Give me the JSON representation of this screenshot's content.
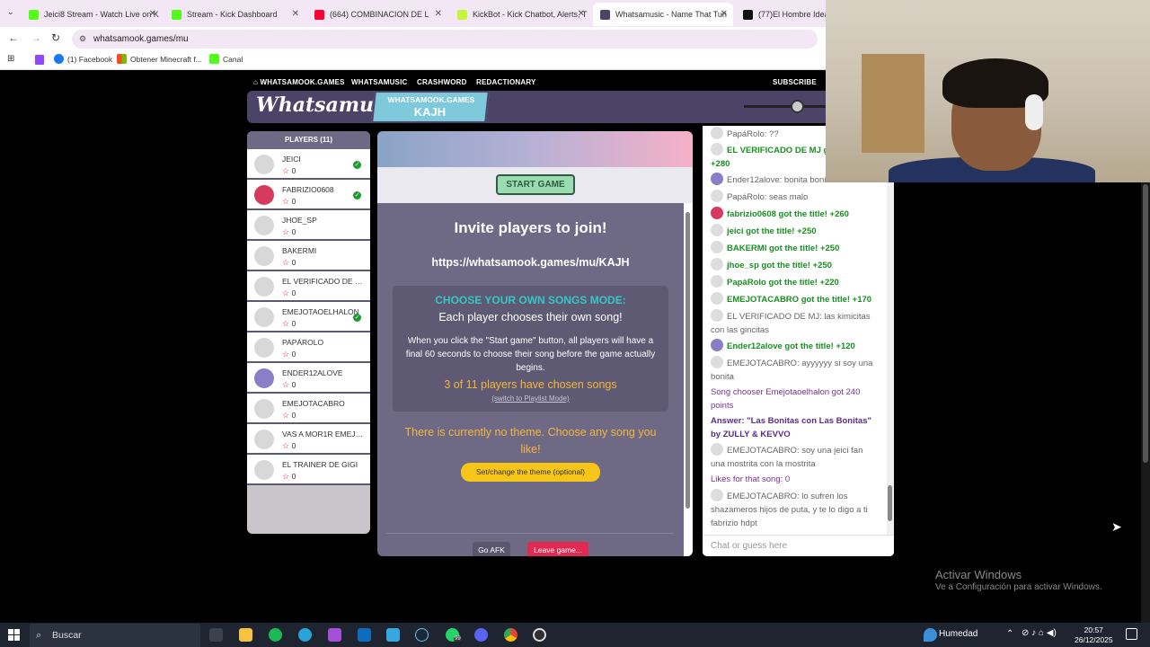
{
  "browser": {
    "tabs": [
      {
        "label": "Jeici8 Stream - Watch Live on K",
        "color": "#53fc18"
      },
      {
        "label": "Stream - Kick Dashboard",
        "color": "#53fc18"
      },
      {
        "label": "(664) COMBINACION DE L",
        "color": "#ff0033"
      },
      {
        "label": "KickBot - Kick Chatbot, Alerts, T",
        "color": "#c3f53c"
      },
      {
        "label": "Whatsamusic - Name That Tun",
        "color": "#4c4468"
      },
      {
        "label": "(77)El Hombre Ideal: U",
        "color": "#111111"
      }
    ],
    "url": "whatsamook.games/mu",
    "bookmarks": [
      "(1) Facebook",
      "Obtener Minecraft f...",
      "Canal"
    ]
  },
  "site": {
    "nav": {
      "home": "WHATSAMOOK.GAMES",
      "music": "WHATSAMUSIC",
      "crash": "CRASHWORD",
      "redact": "REDACTIONARY",
      "subscribe": "SUBSCRIBE"
    },
    "logo": "Whatsamusic",
    "room_site": "WHATSAMOOK.GAMES",
    "room_code": "KAJH"
  },
  "players": {
    "header": "PLAYERS (11)",
    "list": [
      {
        "name": "JEICI",
        "score": "0",
        "ready": true,
        "avatar_color": "#d8d8d8"
      },
      {
        "name": "FABRIZIO0608",
        "score": "0",
        "ready": true,
        "avatar_color": "#d63a5e"
      },
      {
        "name": "JHOE_SP",
        "score": "0",
        "ready": false,
        "avatar_color": "#d8d8d8"
      },
      {
        "name": "BAKERMI",
        "score": "0",
        "ready": false,
        "avatar_color": "#d8d8d8"
      },
      {
        "name": "EL VERIFICADO DE MJ",
        "score": "0",
        "ready": false,
        "avatar_color": "#d8d8d8"
      },
      {
        "name": "EMEJOTAOELHALON",
        "score": "0",
        "ready": true,
        "avatar_color": "#d8d8d8"
      },
      {
        "name": "PAPÁROLO",
        "score": "0",
        "ready": false,
        "avatar_color": "#d8d8d8"
      },
      {
        "name": "ENDER12ALOVE",
        "score": "0",
        "ready": false,
        "avatar_color": "#8a7fc7"
      },
      {
        "name": "EMEJOTACABRO",
        "score": "0",
        "ready": false,
        "avatar_color": "#d8d8d8"
      },
      {
        "name": "VAS A MOR1R EMEJO...",
        "score": "0",
        "ready": false,
        "avatar_color": "#d8d8d8"
      },
      {
        "name": "EL TRAINER DE GIGI",
        "score": "0",
        "ready": false,
        "avatar_color": "#d8d8d8"
      }
    ]
  },
  "game": {
    "start_label": "START GAME",
    "invite_title": "Invite players to join!",
    "invite_url": "https://whatsamook.games/mu/KAJH",
    "mode_title": "CHOOSE YOUR OWN SONGS MODE:",
    "mode_sub": "Each player chooses their own song!",
    "mode_desc": "When you click the \"Start game\" button, all players will have a final 60 seconds to choose their song before the game actually begins.",
    "chosen": "3 of 11 players have chosen songs",
    "switch_link": "(switch to Playlist Mode)",
    "no_theme": "There is currently no theme. Choose any song you like!",
    "theme_button": "Set/change the theme (optional)",
    "afk_button": "Go AFK",
    "leave_button": "Leave game..."
  },
  "chat": {
    "messages": [
      {
        "text": "PapáRolo: ??",
        "style": "normal",
        "avatar": true
      },
      {
        "text": "EL VERIFICADO DE MJ got the title! +280",
        "style": "green",
        "avatar": true
      },
      {
        "text": "Ender12alove: bonita bonita",
        "style": "normal",
        "avatar": true
      },
      {
        "text": "PapáRolo: seas malo",
        "style": "normal",
        "avatar": true
      },
      {
        "text": "fabrizio0608 got the title! +260",
        "style": "green",
        "avatar": true
      },
      {
        "text": "jeici got the title! +250",
        "style": "green",
        "avatar": true
      },
      {
        "text": "BAKERMI got the title! +250",
        "style": "green",
        "avatar": true
      },
      {
        "text": "jhoe_sp got the title! +250",
        "style": "green",
        "avatar": true
      },
      {
        "text": "PapáRolo got the title! +220",
        "style": "green",
        "avatar": true
      },
      {
        "text": "EMEJOTACABRO got the title! +170",
        "style": "green",
        "avatar": true
      },
      {
        "text": "EL VERIFICADO DE MJ: las kimicitas con las gincitas",
        "style": "normal",
        "avatar": true
      },
      {
        "text": "Ender12alove got the title! +120",
        "style": "green",
        "avatar": true
      },
      {
        "text": "EMEJOTACABRO: ayyyyyy si soy una bonita",
        "style": "normal",
        "avatar": true
      },
      {
        "text": "Song chooser Emejotaoelhalon got 240 points",
        "style": "purple",
        "avatar": false
      },
      {
        "text": "Answer: \"Las Bonitas con Las Bonitas\" by ZULLY & KEVVO",
        "style": "bpurple",
        "avatar": false
      },
      {
        "text": "EMEJOTACABRO: soy una jeici fan una mostrita con la mostrita",
        "style": "normal",
        "avatar": true
      },
      {
        "text": "Likes for that song: 0",
        "style": "purple",
        "avatar": false
      },
      {
        "text": "EMEJOTACABRO: lo sufren los shazameros hijos de puta, y te lo digo a ti fabrizio hdpt",
        "style": "normal",
        "avatar": true
      }
    ],
    "input_placeholder": "Chat or guess here"
  },
  "windows": {
    "activate_title": "Activar Windows",
    "activate_sub": "Ve a Configuración para activar Windows.",
    "search": "Buscar",
    "weather": "Humedad",
    "time": "20:57",
    "date": "26/12/2025",
    "badge": "99"
  }
}
